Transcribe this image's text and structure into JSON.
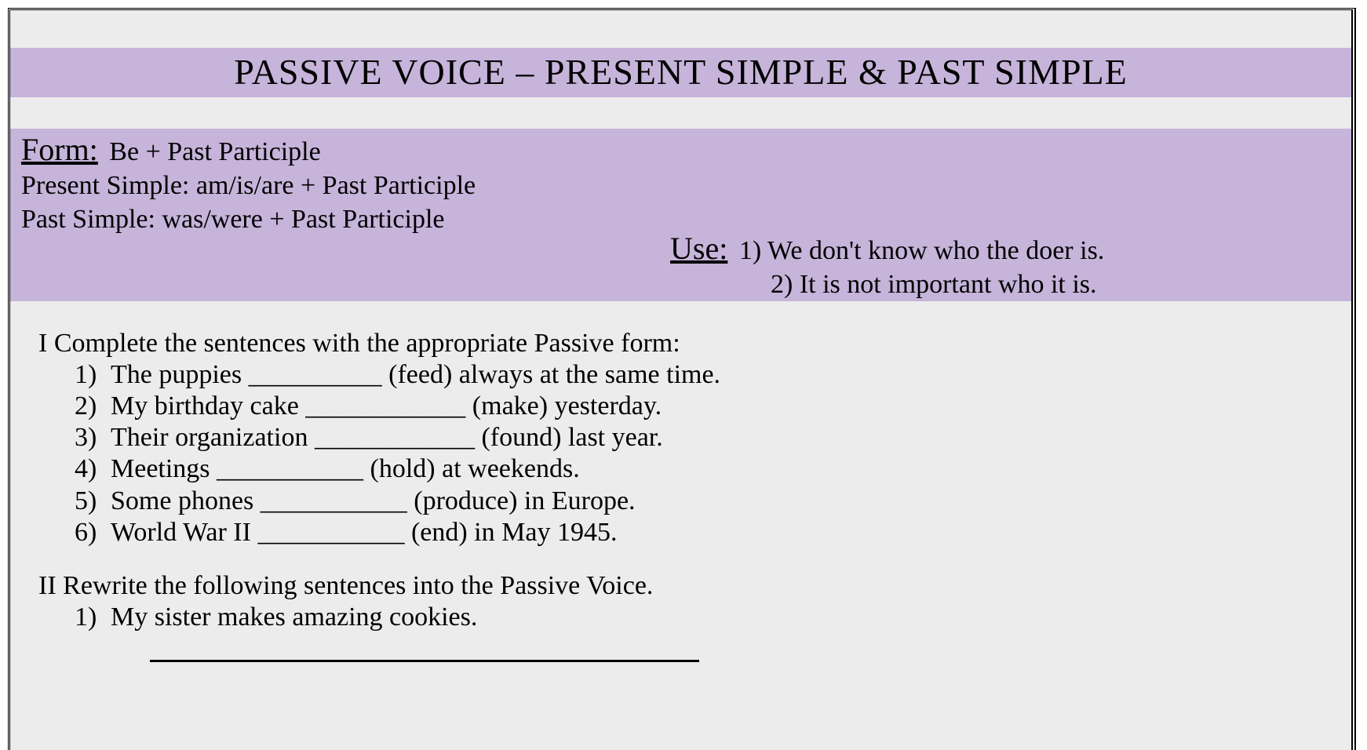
{
  "title": "PASSIVE VOICE – PRESENT SIMPLE & PAST SIMPLE",
  "form": {
    "label": "Form:",
    "main": "Be + Past Participle",
    "present": "Present Simple: am/is/are + Past Participle",
    "past": "Past Simple: was/were + Past Participle"
  },
  "use": {
    "label": "Use:",
    "line1": "1) We don't know who the doer is.",
    "line2": "2) It is not important who it is."
  },
  "exercise1": {
    "heading": "I Complete the sentences with the appropriate Passive form:",
    "items": [
      "The puppies __________ (feed) always at the same time.",
      "My birthday cake ____________ (make) yesterday.",
      "Their organization ____________ (found) last year.",
      "Meetings ___________ (hold) at weekends.",
      "Some phones ___________ (produce) in Europe.",
      "World War II ___________ (end) in May 1945."
    ]
  },
  "exercise2": {
    "heading": "II Rewrite the following sentences into the Passive Voice.",
    "items": [
      "My sister makes amazing cookies."
    ]
  },
  "numbers": [
    "1)",
    "2)",
    "3)",
    "4)",
    "5)",
    "6)"
  ]
}
